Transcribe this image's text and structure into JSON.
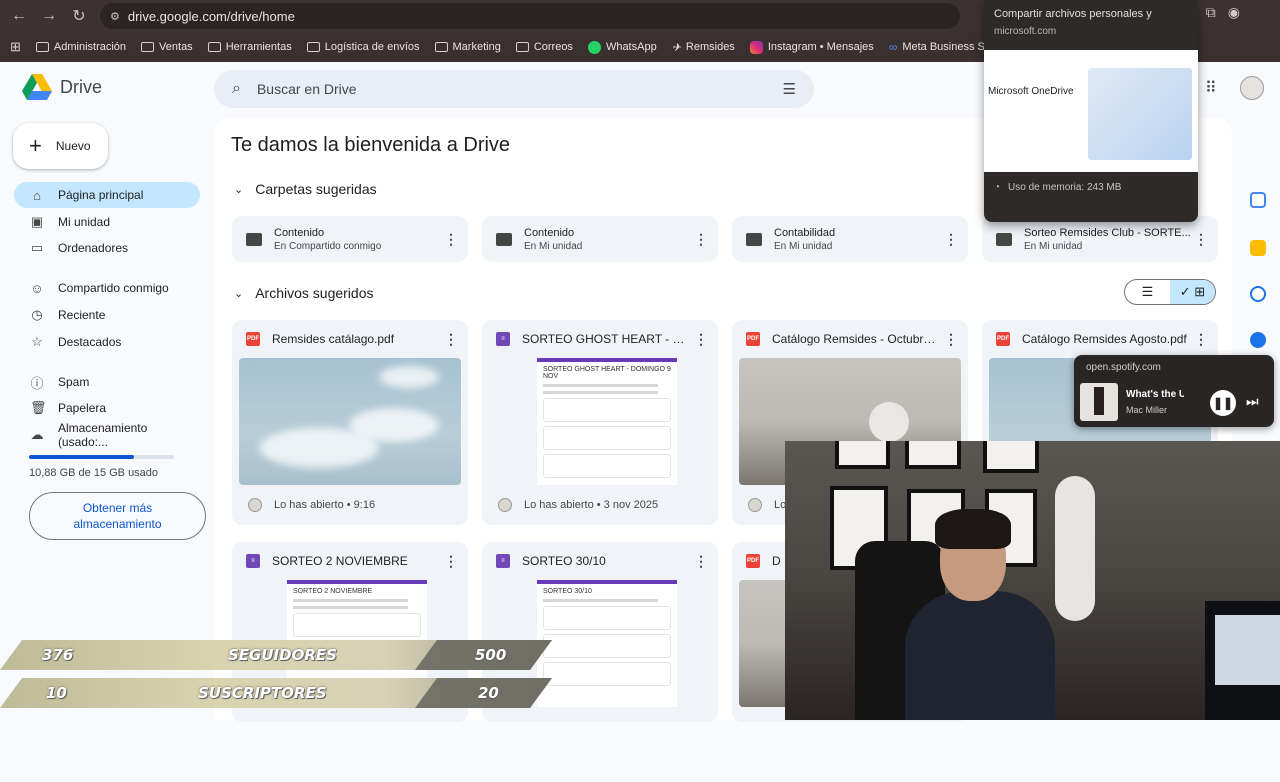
{
  "browser": {
    "url": "drive.google.com/drive/home",
    "bookmarks": [
      "Administración",
      "Ventas",
      "Herramientas",
      "Logística de envíos",
      "Marketing",
      "Correos",
      "WhatsApp",
      "Remsides",
      "Instagram • Mensajes",
      "Meta Business Suite"
    ]
  },
  "tab_preview": {
    "title": "Compartir archivos personales y",
    "domain": "microsoft.com",
    "image_heading": "Microsoft OneDrive",
    "memory": "Uso de memoria: 243 MB"
  },
  "drive": {
    "logo": "Drive",
    "search_placeholder": "Buscar en Drive",
    "new_label": "Nuevo",
    "nav": [
      {
        "label": "Página principal",
        "icon": "home-icon"
      },
      {
        "label": "Mi unidad",
        "icon": "drive-icon"
      },
      {
        "label": "Ordenadores",
        "icon": "computer-icon"
      },
      {
        "label": "Compartido conmigo",
        "icon": "people-icon"
      },
      {
        "label": "Reciente",
        "icon": "clock-icon"
      },
      {
        "label": "Destacados",
        "icon": "star-icon"
      },
      {
        "label": "Spam",
        "icon": "spam-icon"
      },
      {
        "label": "Papelera",
        "icon": "trash-icon"
      },
      {
        "label": "Almacenamiento (usado:...",
        "icon": "cloud-icon"
      }
    ],
    "storage": {
      "text": "10,88 GB de 15 GB usado",
      "fraction": 0.725,
      "button": "Obtener más almacenamiento"
    },
    "welcome": "Te damos la bienvenida a Drive",
    "folders_title": "Carpetas sugeridas",
    "folders": [
      {
        "name": "Contenido",
        "location": "En Compartido conmigo"
      },
      {
        "name": "Contenido",
        "location": "En Mi unidad"
      },
      {
        "name": "Contabilidad",
        "location": "En Mi unidad"
      },
      {
        "name": "Sorteo Remsides Club - SORTE...",
        "location": "En Mi unidad"
      }
    ],
    "files_title": "Archivos sugeridos",
    "files": [
      {
        "name": "Remsides catálago.pdf",
        "type": "pdf",
        "footer": "Lo has abierto • 9:16"
      },
      {
        "name": "SORTEO GHOST HEART - DOM...",
        "type": "form",
        "footer": "Lo has abierto • 3 nov 2025",
        "form_title": "SORTEO GHOST HEART - DOMINGO 9 NOV"
      },
      {
        "name": "Catálogo Remsides - Octubre....",
        "type": "pdf",
        "footer": "Lo"
      },
      {
        "name": "Catálogo Remsides Agosto.pdf",
        "type": "pdf",
        "footer": ""
      },
      {
        "name": "SORTEO 2 NOVIEMBRE",
        "type": "form",
        "form_title": "SORTEO 2 NOVIEMBRE"
      },
      {
        "name": "SORTEO 30/10",
        "type": "form",
        "form_title": "SORTEO 30/10"
      },
      {
        "name": "D",
        "type": "pdf"
      }
    ]
  },
  "spotify": {
    "source": "open.spotify.com",
    "song": "What's the U",
    "artist": "Mac Miller"
  },
  "counters": [
    {
      "current": "376",
      "label": "SEGUIDORES",
      "goal": "500"
    },
    {
      "current": "10",
      "label": "SUSCRIPTORES",
      "goal": "20"
    }
  ]
}
